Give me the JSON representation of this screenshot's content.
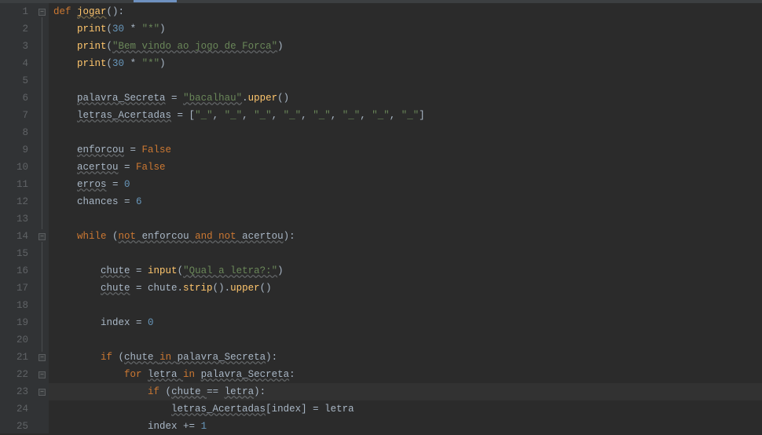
{
  "editor": {
    "lines": [
      1,
      2,
      3,
      4,
      5,
      6,
      7,
      8,
      9,
      10,
      11,
      12,
      13,
      14,
      15,
      16,
      17,
      18,
      19,
      20,
      21,
      22,
      23,
      24,
      25
    ],
    "highlighted_line": 23,
    "fold_markers": [
      {
        "line": 1,
        "state": "open"
      },
      {
        "line": 14,
        "state": "open"
      },
      {
        "line": 21,
        "state": "open"
      },
      {
        "line": 22,
        "state": "open"
      },
      {
        "line": 23,
        "state": "open"
      }
    ]
  },
  "code": {
    "l1": {
      "kw": "def ",
      "fn": "jogar",
      "rest": "():"
    },
    "l2": {
      "ind": "    ",
      "fn": "print",
      "op1": "(",
      "num": "30",
      "op2": " * ",
      "str": "\"*\"",
      "op3": ")"
    },
    "l3": {
      "ind": "    ",
      "fn": "print",
      "op1": "(",
      "str": "\"Bem vindo ao jogo de Forca\"",
      "op2": ")"
    },
    "l4": {
      "ind": "    ",
      "fn": "print",
      "op1": "(",
      "num": "30",
      "op2": " * ",
      "str": "\"*\"",
      "op3": ")"
    },
    "l6": {
      "ind": "    ",
      "var": "palavra_Secreta",
      "eq": " = ",
      "str": "\"bacalhau\"",
      "dot": ".",
      "m": "upper",
      "call": "()"
    },
    "l7": {
      "ind": "    ",
      "var": "letras_Acertadas",
      "eq": " = [",
      "s1": "\"_\"",
      "c": ", ",
      "s2": "\"_\"",
      "s3": "\"_\"",
      "s4": "\"_\"",
      "s5": "\"_\"",
      "s6": "\"_\"",
      "s7": "\"_\"",
      "s8": "\"_\"",
      "close": "]"
    },
    "l9": {
      "ind": "    ",
      "var": "enforcou",
      "eq": " = ",
      "kw": "False"
    },
    "l10": {
      "ind": "    ",
      "var": "acertou",
      "eq": " = ",
      "kw": "False"
    },
    "l11": {
      "ind": "    ",
      "var": "erros",
      "eq": " = ",
      "num": "0"
    },
    "l12": {
      "ind": "    ",
      "var": "chances",
      "eq": " = ",
      "num": "6"
    },
    "l14": {
      "ind": "    ",
      "kw1": "while ",
      "op1": "(",
      "kw2": "not ",
      "v1": "enforcou ",
      "kw3": "and not ",
      "v2": "acertou",
      "op2": "):"
    },
    "l16": {
      "ind": "        ",
      "var": "chute",
      "eq": " = ",
      "fn": "input",
      "op1": "(",
      "str": "\"Qual a letra?:\"",
      "op2": ")"
    },
    "l17": {
      "ind": "        ",
      "var": "chute",
      "eq": " = chute.",
      "m1": "strip",
      "c1": "().",
      "m2": "upper",
      "c2": "()"
    },
    "l19": {
      "ind": "        ",
      "var": "index",
      "eq": " = ",
      "num": "0"
    },
    "l21": {
      "ind": "        ",
      "kw": "if ",
      "op1": "(",
      "v1": "chute ",
      "kw2": "in ",
      "v2": "palavra_Secreta",
      "op2": "):"
    },
    "l22": {
      "ind": "            ",
      "kw": "for ",
      "v1": "letra ",
      "kw2": "in ",
      "v2": "palavra_Secreta",
      "op": ":"
    },
    "l23": {
      "ind": "                ",
      "kw": "if ",
      "op1": "(",
      "v1": "chute ",
      "op2": "== ",
      "v2": "letra",
      "op3": "):"
    },
    "l24": {
      "ind": "                    ",
      "var": "letras_Acertadas",
      "idx": "[index] = letra"
    },
    "l25": {
      "ind": "                ",
      "var": "index",
      "op": " += ",
      "num": "1"
    }
  }
}
